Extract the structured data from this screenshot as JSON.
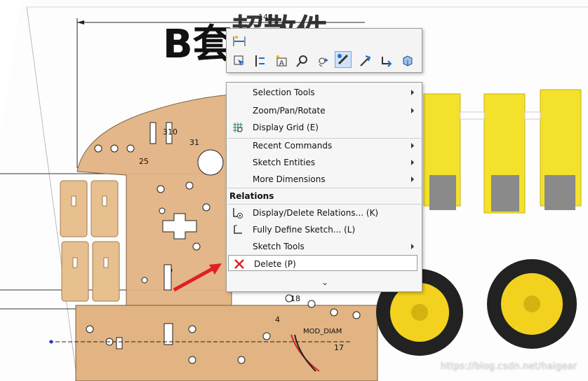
{
  "drawing": {
    "title": "B套",
    "dimension_top": "148",
    "dims": [
      "31",
      "310",
      "25",
      "18",
      "4",
      "17",
      "MOD_DIAM"
    ]
  },
  "toolbar": {
    "icons": [
      "smart-dimension-icon",
      "select-icon",
      "sketch-relations-icon",
      "annotation-icon",
      "zoom-icon",
      "view-orient-icon",
      "sketch-active-icon",
      "line-icon",
      "rotate-icon",
      "3d-view-icon"
    ]
  },
  "menu": {
    "items": [
      {
        "label": "Selection Tools",
        "submenu": true
      },
      {
        "label": "Zoom/Pan/Rotate",
        "submenu": true
      },
      {
        "label": "Display Grid (E)",
        "submenu": false,
        "icon": "grid-icon"
      },
      {
        "label": "Recent Commands",
        "submenu": true
      },
      {
        "label": "Sketch Entities",
        "submenu": true
      },
      {
        "label": "More Dimensions",
        "submenu": true
      }
    ],
    "section_title": "Relations",
    "relations": [
      {
        "label": "Display/Delete Relations... (K)",
        "icon": "relations-icon"
      },
      {
        "label": "Fully Define Sketch... (L)",
        "icon": "fully-define-icon"
      },
      {
        "label": "Sketch Tools",
        "submenu": true
      },
      {
        "label": "Delete (P)",
        "icon": "delete-icon",
        "highlight": true
      }
    ],
    "expand_glyph": "⌄"
  },
  "watermark": "https://blog.csdn.net/haigear",
  "colors": {
    "accent": "#d92323",
    "board": "#e5b98a",
    "motor": "#f6e22c",
    "menu_bg": "#f6f6f6"
  }
}
